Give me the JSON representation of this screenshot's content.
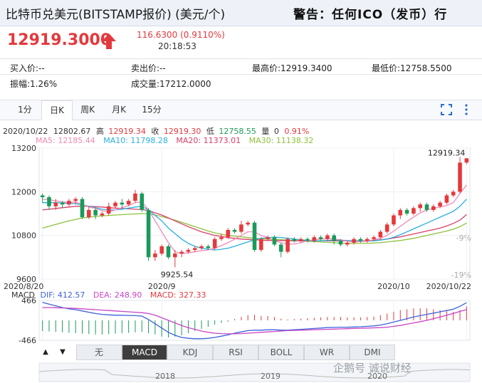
{
  "header": {
    "title": "比特币兑美元(BITSTAMP报价) (美元/个)",
    "warning": "警告：任何ICO（发币）行"
  },
  "quote": {
    "price": "12919.3000",
    "change": "116.6300 (0.9110%)",
    "time": "20:18:53"
  },
  "stats": {
    "bid": "买入价:--",
    "ask": "卖出价:--",
    "high": "最高价:12919.3400",
    "low": "最低价:12758.5500",
    "amplitude": "振幅:1.26%",
    "volume": "成交量:17212.0000"
  },
  "tabs": [
    "1分",
    "日K",
    "周K",
    "月K",
    "15分"
  ],
  "active_tab": "日K",
  "icons": {
    "fullscreen": "fullscreen-icon",
    "more": "more-vertical-icon",
    "up": "up-arrow-icon"
  },
  "info": {
    "date": "2020/10/22",
    "open": "12802.67",
    "high_label": "高",
    "high": "12919.34",
    "close_label": "收",
    "close": "12919.30",
    "low_label": "低",
    "low": "12758.55",
    "vol_label": "量",
    "vol": "0",
    "pct": "0.91%"
  },
  "ma": {
    "ma5": "MA5: 12185.44",
    "ma10": "MA10: 11798.28",
    "ma20": "MA20: 11373.01",
    "ma30": "MA30: 11138.32"
  },
  "colors": {
    "up": "#e4393c",
    "down": "#1a9a5a",
    "ma5": "#f08ab4",
    "ma10": "#2ab0e0",
    "ma20": "#d94068",
    "ma30": "#8fc13c",
    "dif": "#3b63d8",
    "dea": "#c845c8"
  },
  "chart_data": {
    "type": "candlestick",
    "y_ticks": [
      "13200",
      "12000",
      "10800",
      "9600"
    ],
    "right_pct_ticks": [
      "-9%",
      "-19%"
    ],
    "x_ticks": [
      "2020/8/20",
      "2020/9",
      "2020/10",
      "2020/10/22"
    ],
    "high_annotation": "12919.34",
    "low_annotation": "9925.54",
    "ylim": [
      9600,
      13200
    ],
    "candles": [
      [
        11900,
        11850,
        11950,
        11700
      ],
      [
        11850,
        11600,
        11900,
        11500
      ],
      [
        11600,
        11700,
        11800,
        11500
      ],
      [
        11700,
        11650,
        11750,
        11550
      ],
      [
        11650,
        11750,
        11800,
        11600
      ],
      [
        11750,
        11800,
        11850,
        11650
      ],
      [
        11800,
        11300,
        11850,
        11250
      ],
      [
        11300,
        11500,
        11600,
        11250
      ],
      [
        11500,
        11350,
        11550,
        11250
      ],
      [
        11350,
        11400,
        11450,
        11300
      ],
      [
        11400,
        11600,
        11700,
        11350
      ],
      [
        11600,
        11700,
        11750,
        11550
      ],
      [
        11700,
        11650,
        11800,
        11550
      ],
      [
        11650,
        11750,
        11800,
        11600
      ],
      [
        11750,
        11950,
        12050,
        11700
      ],
      [
        11950,
        11500,
        12000,
        11450
      ],
      [
        11500,
        10200,
        11550,
        10100
      ],
      [
        10200,
        10300,
        10400,
        10100
      ],
      [
        10300,
        10500,
        10550,
        10250
      ],
      [
        10500,
        10200,
        10550,
        10150
      ],
      [
        10200,
        10300,
        10400,
        9925
      ],
      [
        10300,
        10350,
        10400,
        10200
      ],
      [
        10350,
        10400,
        10450,
        10300
      ],
      [
        10400,
        10450,
        10500,
        10350
      ],
      [
        10450,
        10500,
        10550,
        10400
      ],
      [
        10500,
        10450,
        10550,
        10400
      ],
      [
        10450,
        10700,
        10750,
        10400
      ],
      [
        10700,
        10750,
        10850,
        10650
      ],
      [
        10750,
        10950,
        11000,
        10700
      ],
      [
        10950,
        10900,
        11000,
        10850
      ],
      [
        10900,
        11100,
        11200,
        10850
      ],
      [
        11100,
        11150,
        11200,
        11050
      ],
      [
        11150,
        10400,
        11200,
        10350
      ],
      [
        10400,
        10700,
        10750,
        10350
      ],
      [
        10700,
        10750,
        10800,
        10650
      ],
      [
        10750,
        10550,
        10800,
        10500
      ],
      [
        10550,
        10350,
        10600,
        10200
      ],
      [
        10350,
        10700,
        10750,
        10300
      ],
      [
        10700,
        10650,
        10750,
        10600
      ],
      [
        10650,
        10700,
        10750,
        10600
      ],
      [
        10700,
        10650,
        10750,
        10600
      ],
      [
        10650,
        10750,
        10800,
        10600
      ],
      [
        10750,
        10700,
        10800,
        10650
      ],
      [
        10700,
        10800,
        10850,
        10650
      ],
      [
        10800,
        10650,
        10850,
        10550
      ],
      [
        10650,
        10550,
        10700,
        10500
      ],
      [
        10550,
        10600,
        10650,
        10500
      ],
      [
        10600,
        10700,
        10750,
        10550
      ],
      [
        10700,
        10650,
        10750,
        10600
      ],
      [
        10650,
        10700,
        10750,
        10600
      ],
      [
        10700,
        10750,
        10800,
        10650
      ],
      [
        10750,
        10900,
        10950,
        10700
      ],
      [
        10900,
        11100,
        11150,
        10850
      ],
      [
        11100,
        11350,
        11400,
        11050
      ],
      [
        11350,
        11500,
        11550,
        11250
      ],
      [
        11500,
        11400,
        11550,
        11350
      ],
      [
        11400,
        11550,
        11600,
        11350
      ],
      [
        11550,
        11650,
        11700,
        11450
      ],
      [
        11650,
        11500,
        11700,
        11450
      ],
      [
        11500,
        11600,
        11650,
        11450
      ],
      [
        11600,
        11700,
        11750,
        11550
      ],
      [
        11700,
        11900,
        11950,
        11650
      ],
      [
        11900,
        12000,
        12050,
        11850
      ],
      [
        12000,
        12800,
        12950,
        11950
      ],
      [
        12802.67,
        12919.3,
        12919.34,
        12758.55
      ]
    ],
    "ma_lines": {
      "ma5": [
        11800,
        11780,
        11750,
        11720,
        11700,
        11720,
        11640,
        11580,
        11540,
        11480,
        11450,
        11500,
        11560,
        11620,
        11700,
        11720,
        11500,
        11200,
        10900,
        10600,
        10350,
        10300,
        10320,
        10350,
        10380,
        10400,
        10450,
        10520,
        10600,
        10700,
        10800,
        10900,
        10900,
        10800,
        10750,
        10650,
        10600,
        10560,
        10560,
        10600,
        10650,
        10680,
        10700,
        10710,
        10700,
        10680,
        10640,
        10620,
        10630,
        10640,
        10680,
        10720,
        10800,
        10920,
        11050,
        11180,
        11300,
        11420,
        11500,
        11540,
        11580,
        11620,
        11700,
        11950,
        12185
      ],
      "ma10": [
        11700,
        11700,
        11700,
        11690,
        11680,
        11670,
        11640,
        11600,
        11560,
        11520,
        11500,
        11500,
        11520,
        11550,
        11580,
        11600,
        11500,
        11350,
        11200,
        11000,
        10850,
        10700,
        10580,
        10500,
        10450,
        10420,
        10400,
        10420,
        10450,
        10500,
        10560,
        10620,
        10680,
        10720,
        10740,
        10750,
        10740,
        10720,
        10700,
        10680,
        10660,
        10650,
        10650,
        10660,
        10670,
        10670,
        10660,
        10650,
        10640,
        10640,
        10650,
        10670,
        10700,
        10750,
        10820,
        10900,
        10980,
        11060,
        11140,
        11220,
        11300,
        11380,
        11460,
        11600,
        11798
      ],
      "ma20": [
        11500,
        11520,
        11540,
        11560,
        11580,
        11600,
        11600,
        11600,
        11590,
        11580,
        11560,
        11550,
        11540,
        11530,
        11520,
        11510,
        11480,
        11420,
        11360,
        11280,
        11200,
        11120,
        11040,
        10970,
        10900,
        10850,
        10800,
        10770,
        10740,
        10720,
        10700,
        10690,
        10680,
        10670,
        10660,
        10660,
        10660,
        10660,
        10650,
        10650,
        10650,
        10650,
        10650,
        10650,
        10650,
        10650,
        10650,
        10650,
        10650,
        10650,
        10660,
        10680,
        10700,
        10730,
        10760,
        10800,
        10840,
        10880,
        10920,
        10960,
        11000,
        11060,
        11130,
        11220,
        11373
      ],
      "ma30": [
        11000,
        11050,
        11100,
        11150,
        11200,
        11240,
        11280,
        11300,
        11320,
        11340,
        11350,
        11360,
        11370,
        11380,
        11390,
        11400,
        11390,
        11360,
        11320,
        11270,
        11220,
        11160,
        11100,
        11040,
        10980,
        10920,
        10870,
        10830,
        10800,
        10780,
        10760,
        10740,
        10720,
        10710,
        10700,
        10690,
        10680,
        10670,
        10660,
        10650,
        10640,
        10630,
        10620,
        10610,
        10600,
        10590,
        10580,
        10580,
        10580,
        10580,
        10590,
        10600,
        10620,
        10640,
        10660,
        10690,
        10720,
        10760,
        10800,
        10840,
        10880,
        10920,
        10970,
        11040,
        11138
      ]
    },
    "macd": {
      "label": "MACD",
      "dif_label": "DIF: 412.57",
      "dea_label": "DEA: 248.90",
      "macd_label": "MACD: 327.33",
      "y_ticks": [
        "466",
        "-466"
      ],
      "dif": [
        420,
        380,
        340,
        300,
        270,
        250,
        220,
        190,
        160,
        140,
        130,
        120,
        120,
        115,
        110,
        100,
        20,
        -80,
        -180,
        -280,
        -350,
        -400,
        -420,
        -430,
        -430,
        -420,
        -400,
        -370,
        -340,
        -300,
        -270,
        -240,
        -230,
        -230,
        -220,
        -220,
        -230,
        -230,
        -220,
        -210,
        -200,
        -190,
        -180,
        -170,
        -165,
        -160,
        -160,
        -155,
        -150,
        -140,
        -130,
        -110,
        -80,
        -40,
        0,
        40,
        80,
        110,
        140,
        170,
        200,
        230,
        260,
        330,
        412
      ],
      "dea": [
        300,
        300,
        295,
        290,
        285,
        280,
        270,
        260,
        250,
        240,
        230,
        220,
        210,
        200,
        190,
        180,
        160,
        120,
        60,
        0,
        -60,
        -120,
        -170,
        -210,
        -250,
        -280,
        -300,
        -310,
        -315,
        -315,
        -310,
        -300,
        -290,
        -280,
        -270,
        -260,
        -250,
        -240,
        -235,
        -230,
        -225,
        -220,
        -215,
        -210,
        -205,
        -200,
        -195,
        -190,
        -185,
        -180,
        -175,
        -170,
        -160,
        -140,
        -120,
        -90,
        -60,
        -30,
        0,
        40,
        80,
        120,
        160,
        210,
        249
      ],
      "hist": [
        -250,
        -260,
        -270,
        -280,
        -290,
        -300,
        -310,
        -320,
        -330,
        -330,
        -320,
        -310,
        -300,
        -290,
        -280,
        -270,
        -300,
        -330,
        -380,
        -400,
        -380,
        -350,
        -300,
        -250,
        -200,
        -150,
        -100,
        -60,
        -30,
        30,
        80,
        120,
        130,
        100,
        100,
        80,
        40,
        20,
        30,
        40,
        50,
        60,
        70,
        80,
        80,
        80,
        70,
        70,
        70,
        80,
        90,
        120,
        160,
        200,
        240,
        260,
        280,
        280,
        280,
        260,
        240,
        220,
        200,
        240,
        327
      ]
    },
    "indicator_tabs": [
      "无",
      "MACD",
      "KDJ",
      "RSI",
      "BOLL",
      "WR",
      "DMI"
    ],
    "active_indicator": "MACD",
    "nav_years": [
      "2018",
      "2019",
      "2020"
    ]
  },
  "watermark": "企鹅号 诚说财经"
}
